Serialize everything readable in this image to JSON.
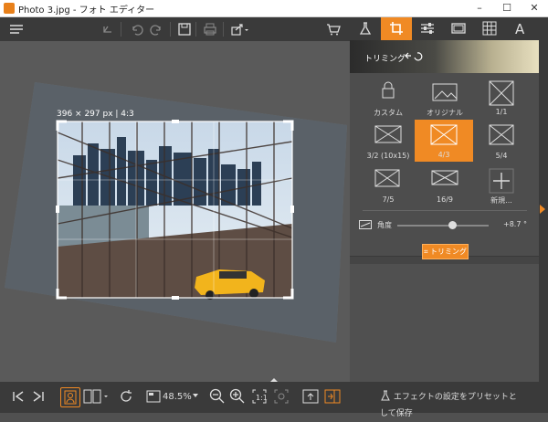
{
  "window": {
    "title": "Photo 3.jpg - フォト エディター",
    "min": "–",
    "max": "☐",
    "close": "✕"
  },
  "toolbar": {
    "icons": [
      "menu-icon",
      "undo-all-icon",
      "undo-icon",
      "redo-icon",
      "save-icon",
      "print-icon",
      "share-icon",
      "cart-icon"
    ]
  },
  "canvas": {
    "crop_size_label": "396 × 297 px | 4:3"
  },
  "panel": {
    "tabs": [
      "effects",
      "crop",
      "adjust",
      "frame",
      "texture",
      "text"
    ],
    "banner_label": "トリミング",
    "ratios": [
      {
        "label": "カスタム"
      },
      {
        "label": "オリジナル"
      },
      {
        "label": "1/1"
      },
      {
        "label": "3/2 (10x15)"
      },
      {
        "label": "4/3"
      },
      {
        "label": "5/4"
      },
      {
        "label": "7/5"
      },
      {
        "label": "16/9"
      },
      {
        "label": "新規..."
      }
    ],
    "selected_ratio": "4/3",
    "angle_label": "角度",
    "angle_value": "+8.7 °",
    "apply_label": "トリミング",
    "preset_label": "エフェクトの設定をプリセットとして保存"
  },
  "bottombar": {
    "zoom": "48.5%"
  },
  "colors": {
    "accent": "#f08a24",
    "panel": "#454545",
    "toolbar": "#3a3a3a"
  }
}
